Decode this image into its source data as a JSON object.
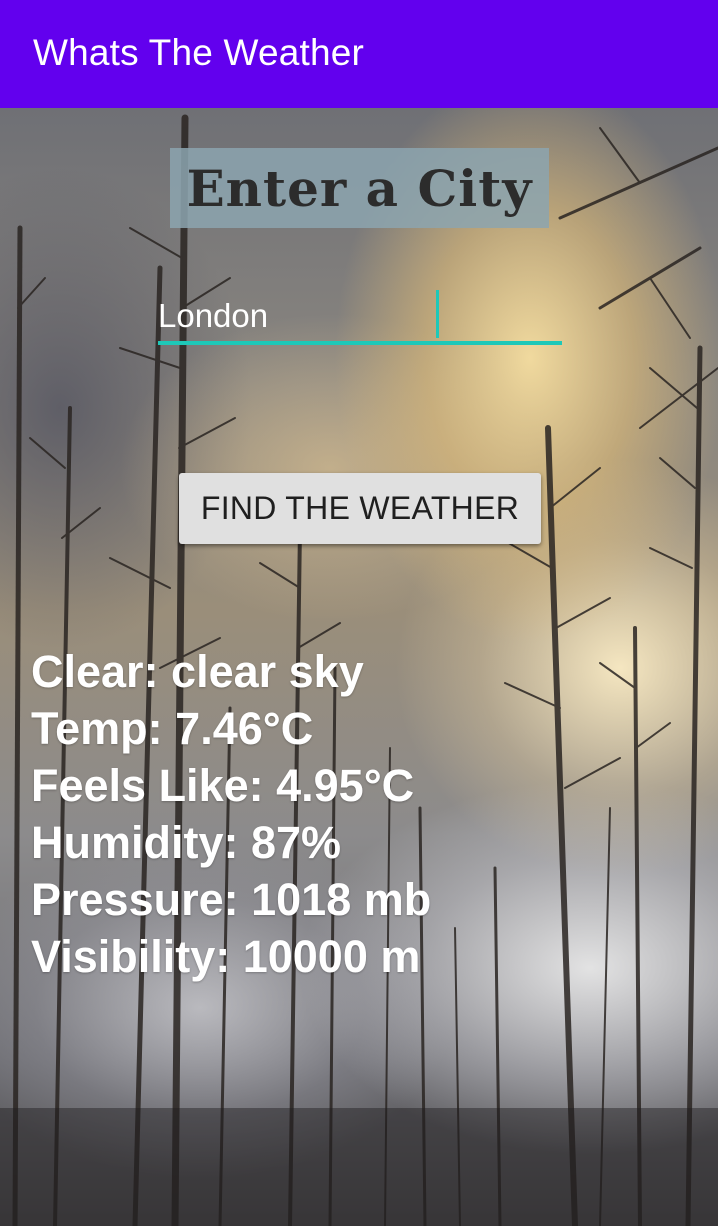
{
  "app_bar": {
    "title": "Whats The Weather",
    "color": "#6200ee"
  },
  "main": {
    "heading": "Enter a City",
    "city_input": {
      "value": "London",
      "placeholder": ""
    },
    "find_button_label": "FIND THE WEATHER",
    "accent_color": "#1ec8b8",
    "background": "forest-storm-sky-image"
  },
  "results": {
    "lines": [
      "Clear: clear sky",
      "Temp: 7.46°C",
      "Feels Like: 4.95°C",
      "Humidity: 87%",
      "Pressure: 1018 mb",
      "Visibility: 10000 m"
    ]
  }
}
